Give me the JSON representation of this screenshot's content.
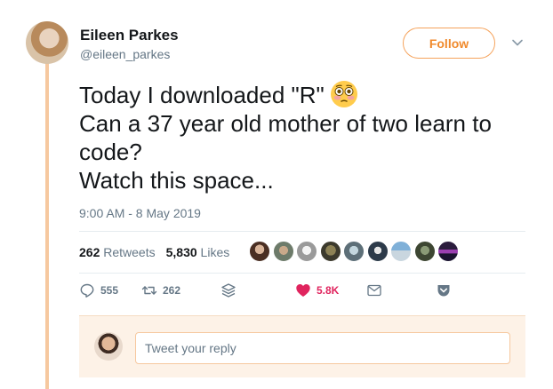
{
  "author": {
    "name": "Eileen Parkes",
    "handle": "@eileen_parkes"
  },
  "follow_label": "Follow",
  "tweet": {
    "lines": [
      "Today I downloaded \"R\"",
      "Can a 37 year old mother of two learn to",
      "code?",
      "Watch this space..."
    ],
    "emoji": "flushed-face-emoji"
  },
  "timestamp": "9:00 AM - 8 May 2019",
  "stats": {
    "retweets_count": "262",
    "retweets_label": "Retweets",
    "likes_count": "5,830",
    "likes_label": "Likes"
  },
  "actions": {
    "replies": "555",
    "retweets": "262",
    "likes": "5.8K"
  },
  "reply": {
    "placeholder": "Tweet your reply"
  },
  "colors": {
    "accent": "#f08a2c",
    "like": "#e0245e",
    "thread": "#f6c89f",
    "secondary_text": "#657786"
  }
}
